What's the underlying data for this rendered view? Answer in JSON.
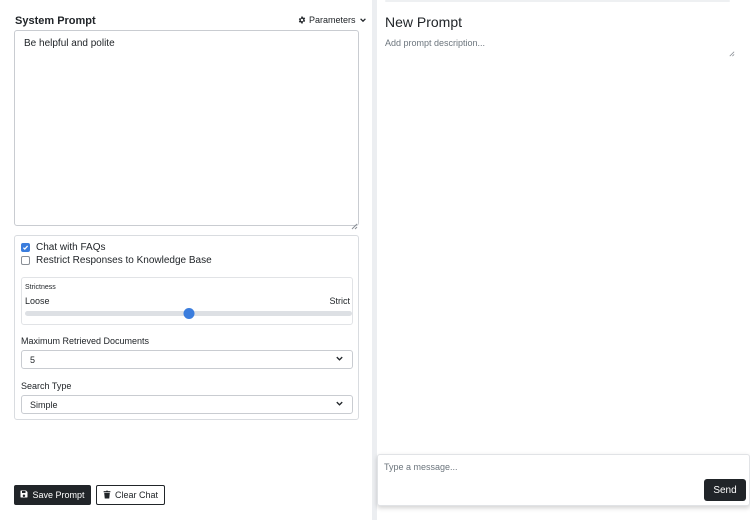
{
  "left": {
    "system_prompt_label": "System Prompt",
    "parameters_label": "Parameters",
    "system_prompt_value": "Be helpful and polite",
    "chat_with_faqs": {
      "label": "Chat with FAQs",
      "checked": true
    },
    "restrict_responses": {
      "label": "Restrict Responses to Knowledge Base",
      "checked": false
    },
    "strictness": {
      "title": "Strictness",
      "min_label": "Loose",
      "max_label": "Strict",
      "value": 0.5
    },
    "max_docs": {
      "label": "Maximum Retrieved Documents",
      "value": "5"
    },
    "search_type": {
      "label": "Search Type",
      "value": "Simple"
    },
    "save_button": "Save Prompt",
    "clear_button": "Clear Chat"
  },
  "right": {
    "title": "New Prompt",
    "description_placeholder": "Add prompt description...",
    "message_placeholder": "Type a message...",
    "send_button": "Send"
  },
  "icons": {
    "parameters": "gear-icon",
    "parameters_toggle": "chevron-down-icon",
    "save": "floppy-disk-icon",
    "clear": "trash-icon",
    "select": "chevron-down-icon"
  },
  "colors": {
    "accent": "#3b7ddd",
    "dark": "#212529"
  }
}
